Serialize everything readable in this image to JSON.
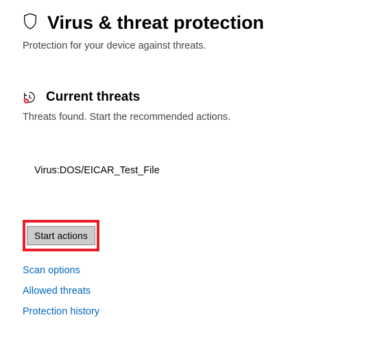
{
  "header": {
    "title": "Virus & threat protection",
    "subtitle": "Protection for your device against threats."
  },
  "section": {
    "title": "Current threats",
    "subtitle": "Threats found. Start the recommended actions."
  },
  "threat": {
    "name": "Virus:DOS/EICAR_Test_File"
  },
  "actions": {
    "start_label": "Start actions"
  },
  "links": {
    "scan_options": "Scan options",
    "allowed_threats": "Allowed threats",
    "protection_history": "Protection history"
  }
}
